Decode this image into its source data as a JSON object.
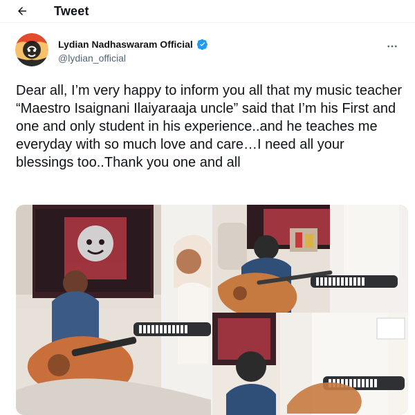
{
  "header": {
    "back_icon": "back-arrow-icon",
    "title": "Tweet"
  },
  "author": {
    "name": "Lydian Nadhaswaram Official",
    "handle": "@lydian_official",
    "verified_icon": "verified-badge-icon",
    "more_icon": "more-horizontal-icon"
  },
  "tweet": {
    "text": "Dear all, I’m very happy to inform you all that my music teacher “Maestro Isaignani Ilaiyaraaja uncle” said that I’m his First and one and only student in his experience..and he teaches me everyday with so much love and care…I need all your blessings too..Thank you one and all"
  },
  "colors": {
    "text": "#0f1419",
    "secondary": "#536471",
    "verified": "#1d9bf0",
    "divider": "#eff3f4"
  }
}
